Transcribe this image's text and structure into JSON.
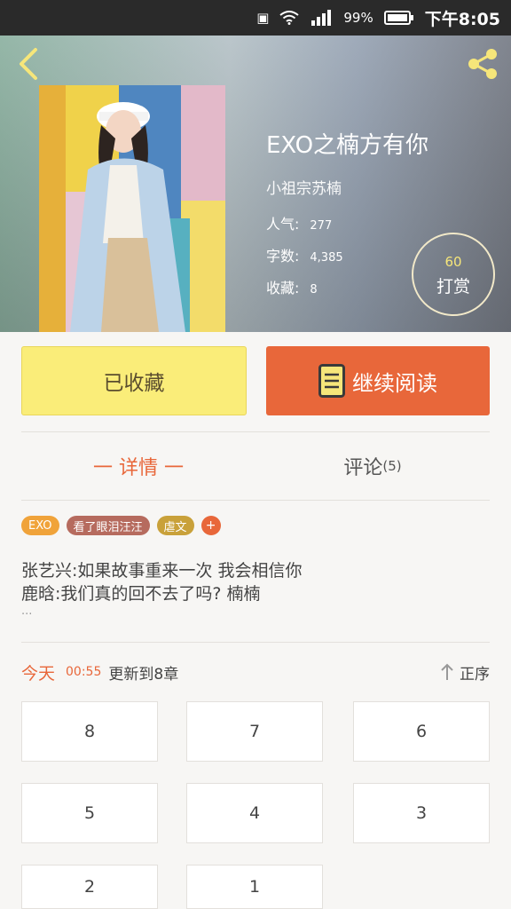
{
  "status_bar": {
    "battery": "99%",
    "time": "下午8:05"
  },
  "header": {
    "back_icon": "back-chevron-icon",
    "share_icon": "share-icon"
  },
  "book": {
    "title": "EXO之楠方有你",
    "author": "小祖宗苏楠",
    "stats": [
      {
        "label": "人气",
        "value": "277"
      },
      {
        "label": "字数",
        "value": "4,385"
      },
      {
        "label": "收藏",
        "value": "8"
      }
    ],
    "tip": {
      "amount": "60",
      "label": "打赏"
    }
  },
  "actions": {
    "favorited_label": "已收藏",
    "read_label": "继续阅读"
  },
  "tabs": {
    "detail": "一 详情 一",
    "comment": "评论",
    "comment_count": "(5)"
  },
  "tags": [
    {
      "label": "EXO",
      "color": "#f0a33a"
    },
    {
      "label": "看了眼泪汪汪",
      "color": "#b66b5e"
    },
    {
      "label": "虐文",
      "color": "#c9a13a"
    }
  ],
  "tag_add": "+",
  "description": {
    "line1": "张艺兴:如果故事重来一次  我会相信你",
    "line2": "鹿晗:我们真的回不去了吗?  楠楠",
    "more": "..."
  },
  "update": {
    "today": "今天",
    "time": "00:55",
    "text": "更新到8章",
    "order": "正序"
  },
  "chapters": [
    "8",
    "7",
    "6",
    "5",
    "4",
    "3",
    "2",
    "1"
  ],
  "colors": {
    "accent": "#e8673a",
    "fav_button": "#faed79"
  }
}
